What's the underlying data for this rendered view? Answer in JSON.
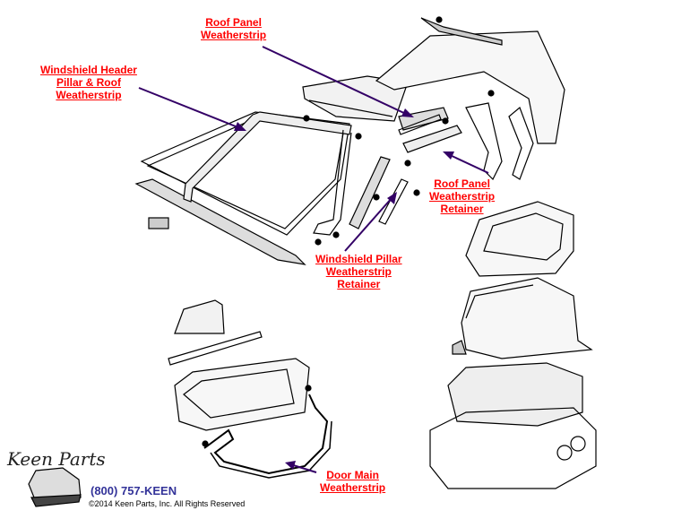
{
  "labels": {
    "roof_panel_weatherstrip": [
      "Roof Panel",
      "Weatherstrip"
    ],
    "windshield_header": [
      "Windshield Header",
      "Pillar & Roof",
      "Weatherstrip"
    ],
    "roof_panel_retainer": [
      "Roof Panel",
      "Weatherstrip",
      "Retainer"
    ],
    "windshield_pillar_retainer": [
      "Windshield Pillar",
      "Weatherstrip",
      "Retainer"
    ],
    "door_main_weatherstrip": [
      "Door Main",
      "Weatherstrip"
    ]
  },
  "footer": {
    "logo": "Keen Parts",
    "phone": "(800) 757-KEEN",
    "copyright": "©2014 Keen Parts, Inc. All Rights Reserved"
  },
  "colors": {
    "label": "#ff0000",
    "arrow": "#330066",
    "phone": "#333399"
  }
}
